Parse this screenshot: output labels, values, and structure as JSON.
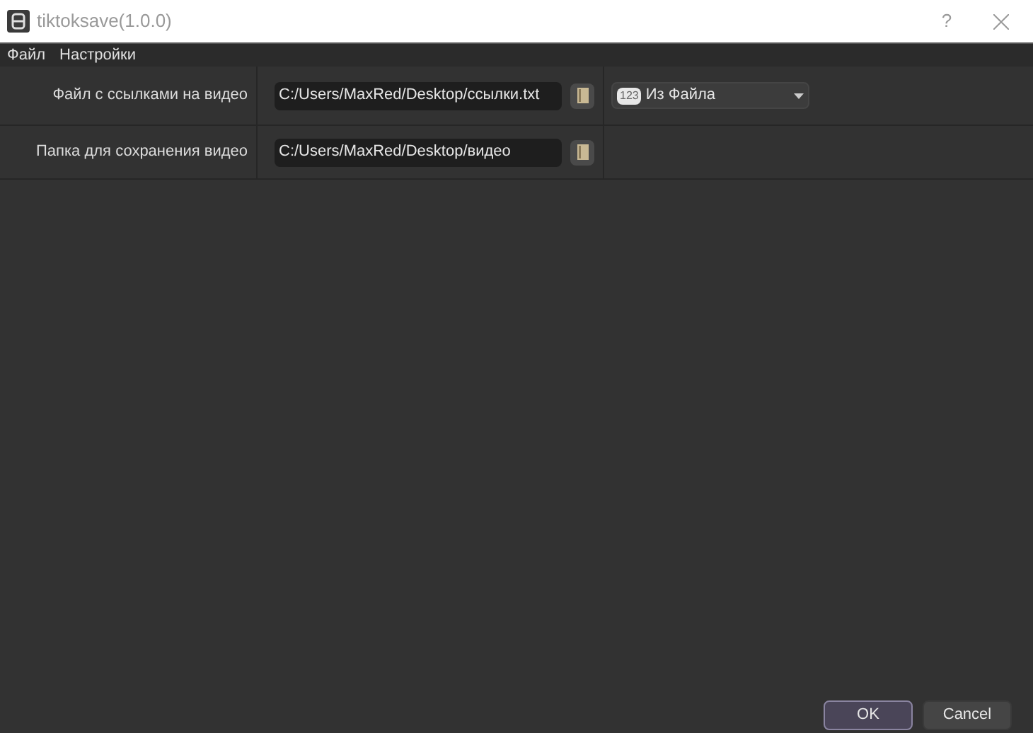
{
  "window": {
    "title": "tiktoksave(1.0.0)",
    "help": "?"
  },
  "menu": [
    "Файл",
    "Настройки"
  ],
  "rows": [
    {
      "label": "Файл с ссылками на видео",
      "value": "C:/Users/MaxRed/Desktop/ссылки.txt",
      "combo": {
        "badge": "123",
        "value": "Из Файла"
      }
    },
    {
      "label": "Папка для сохранения видео",
      "value": "C:/Users/MaxRed/Desktop/видео"
    }
  ],
  "buttons": [
    {
      "label": "OK",
      "selected": true
    },
    {
      "label": "Cancel",
      "selected": false
    }
  ]
}
